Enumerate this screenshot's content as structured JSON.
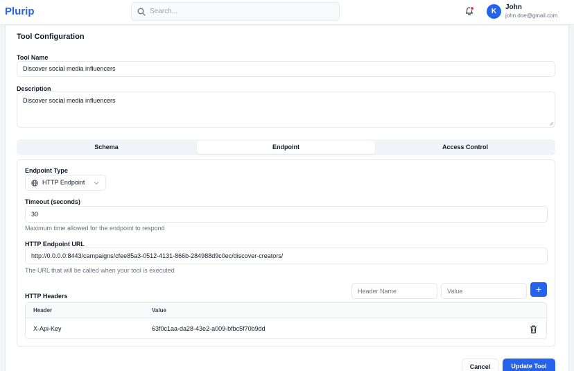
{
  "header": {
    "logo": "Plurip",
    "search_placeholder": "Search...",
    "user": {
      "initial": "K",
      "name": "John",
      "email": "john.doe@gmail.com"
    }
  },
  "form": {
    "title": "Tool Configuration",
    "tool_name_label": "Tool Name",
    "tool_name_value": "Discover social media influencers",
    "description_label": "Description",
    "description_value": "Discover social media influencers"
  },
  "tabs": [
    {
      "label": "Schema",
      "active": false
    },
    {
      "label": "Endpoint",
      "active": true
    },
    {
      "label": "Access Control",
      "active": false
    }
  ],
  "endpoint": {
    "type_label": "Endpoint Type",
    "type_value": "HTTP Endpoint",
    "timeout_label": "Timeout (seconds)",
    "timeout_value": "30",
    "timeout_help": "Maximum time allowed for the endpoint to respond",
    "url_label": "HTTP Endpoint URL",
    "url_value": "http://0.0.0.0:8443/campaigns/cfee85a3-0512-4131-866b-284988d9c0ec/discover-creators/",
    "url_help": "The URL that will be called when your tool is executed",
    "headers_label": "HTTP Headers",
    "header_name_placeholder": "Header Name",
    "header_value_placeholder": "Value",
    "add_icon": "+",
    "columns": [
      "Header",
      "Value"
    ],
    "rows": [
      {
        "header": "X-Api-Key",
        "value": "63f0c1aa-da28-43e2-a009-bfbc5f70b9dd"
      }
    ]
  },
  "actions": {
    "cancel": "Cancel",
    "update": "Update Tool"
  },
  "colors": {
    "accent": "#2563eb",
    "notification": "#ef4444"
  }
}
